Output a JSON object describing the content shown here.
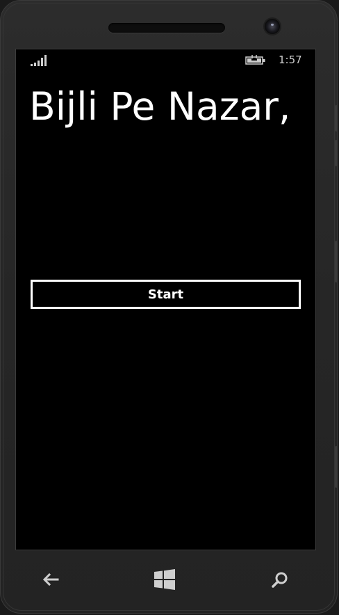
{
  "status_bar": {
    "time": "1:57",
    "signal_icon": "signal-strength-icon",
    "battery_icon": "battery-charging-icon"
  },
  "app": {
    "title": "Bijli Pe Nazar,",
    "start_button_label": "Start"
  },
  "hardware_nav": {
    "back_icon": "back-arrow-icon",
    "home_icon": "windows-logo-icon",
    "search_icon": "search-icon"
  },
  "colors": {
    "screen_background": "#000000",
    "text": "#ffffff",
    "bezel": "#262626"
  }
}
